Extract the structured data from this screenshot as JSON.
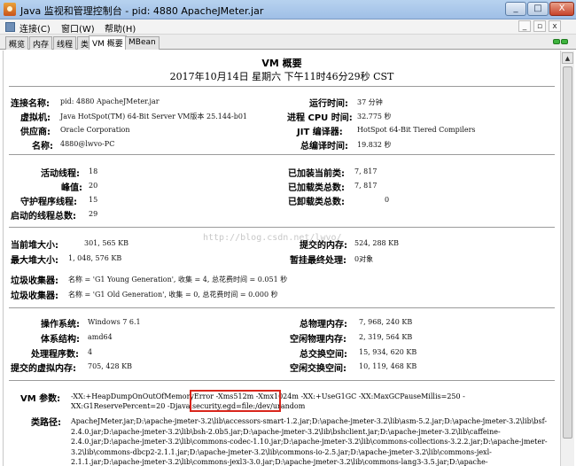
{
  "window": {
    "title": "Java 监视和管理控制台 - pid: 4880 ApacheJMeter.jar",
    "minimize": "_",
    "maximize": "□",
    "close": "X"
  },
  "menu": {
    "items": [
      "连接(C)",
      "窗口(W)",
      "帮助(H)"
    ],
    "mdi_buttons": [
      "_",
      "▫",
      "x"
    ]
  },
  "tabs": [
    "概览",
    "内存",
    "线程",
    "类",
    "VM 概要",
    "MBean"
  ],
  "active_tab": "VM 概要",
  "summary": {
    "title": "VM 概要",
    "date": "2017年10月14日 星期六 下午11时46分29秒 CST",
    "connection": {
      "left": [
        {
          "label": "连接名称:",
          "value": "pid: 4880 ApacheJMeter.jar"
        },
        {
          "label": "虚拟机:",
          "value": "Java HotSpot(TM) 64-Bit Server VM版本 25.144-b01"
        },
        {
          "label": "供应商:",
          "value": "Oracle Corporation"
        },
        {
          "label": "名称:",
          "value": "4880@lwvo-PC"
        }
      ],
      "right": [
        {
          "label": "运行时间:",
          "value": "37 分钟"
        },
        {
          "label": "进程 CPU 时间:",
          "value": "32.775 秒"
        },
        {
          "label": "JIT 编译器:",
          "value": "HotSpot 64-Bit Tiered Compilers"
        },
        {
          "label": "总编译时间:",
          "value": "19.832 秒"
        }
      ]
    },
    "threads": {
      "left": [
        {
          "label": "活动线程:",
          "value": "18"
        },
        {
          "label": "峰值:",
          "value": "20"
        },
        {
          "label": "守护程序线程:",
          "value": "15"
        },
        {
          "label": "启动的线程总数:",
          "value": "29"
        }
      ],
      "right": [
        {
          "label": "已加装当前类:",
          "value": "7, 817"
        },
        {
          "label": "已加载类总数:",
          "value": "7, 817"
        },
        {
          "label": "已卸载类总数:",
          "value": "0"
        }
      ]
    },
    "memory": {
      "heap_label": "当前堆大小:",
      "heap_value": "301, 565 KB",
      "max_heap_label": "最大堆大小:",
      "max_heap_value": "1, 048, 576 KB",
      "committed_label": "提交的内存:",
      "committed_value": "524, 288 KB",
      "pending_label": "暂挂最终处理:",
      "pending_value": "0对象",
      "gc": [
        {
          "label": "垃圾收集器:",
          "value": "名称 = 'G1 Young Generation', 收集 = 4, 总花费时间 = 0.051 秒"
        },
        {
          "label": "垃圾收集器:",
          "value": "名称 = 'G1 Old Generation', 收集 = 0, 总花费时间 = 0.000 秒"
        }
      ]
    },
    "os": {
      "left": [
        {
          "label": "操作系统:",
          "value": "Windows 7 6.1"
        },
        {
          "label": "体系结构:",
          "value": "amd64"
        },
        {
          "label": "处理程序数:",
          "value": "4"
        },
        {
          "label": "提交的虚拟内存:",
          "value": "705, 428 KB"
        }
      ],
      "right": [
        {
          "label": "总物理内存:",
          "value": "7, 968, 240 KB"
        },
        {
          "label": "空闲物理内存:",
          "value": "2, 319, 564 KB"
        },
        {
          "label": "总交换空间:",
          "value": "15, 934, 620 KB"
        },
        {
          "label": "空闲交换空间:",
          "value": "10, 119, 468 KB"
        }
      ]
    },
    "vm_args_label": "VM 参数:",
    "vm_args": "-XX:+HeapDumpOnOutOfMemoryError -Xms512m -Xmx1024m -XX:+UseG1GC -XX:MaxGCPauseMillis=250 -XX:G1ReservePercent=20 -Djava.security.egd=file:/dev/urandom",
    "classpath_label": "类路径:",
    "classpath": "ApacheJMeter.jar;D:\\apache-jmeter-3.2\\lib\\accessors-smart-1.2.jar;D:\\apache-jmeter-3.2\\lib\\asm-5.2.jar;D:\\apache-jmeter-3.2\\lib\\bsf-2.4.0.jar;D:\\apache-jmeter-3.2\\lib\\bsh-2.0b5.jar;D:\\apache-jmeter-3.2\\lib\\bshclient.jar;D:\\apache-jmeter-3.2\\lib\\caffeine-2.4.0.jar;D:\\apache-jmeter-3.2\\lib\\commons-codec-1.10.jar;D:\\apache-jmeter-3.2\\lib\\commons-collections-3.2.2.jar;D:\\apache-jmeter-3.2\\lib\\commons-dbcp2-2.1.1.jar;D:\\apache-jmeter-3.2\\lib\\commons-io-2.5.jar;D:\\apache-jmeter-3.2\\lib\\commons-jexl-2.1.1.jar;D:\\apache-jmeter-3.2\\lib\\commons-jexl3-3.0.jar;D:\\apache-jmeter-3.2\\lib\\commons-lang3-3.5.jar;D:\\apache-",
    "watermark": "http://blog.csdn.net/lwvo/"
  }
}
